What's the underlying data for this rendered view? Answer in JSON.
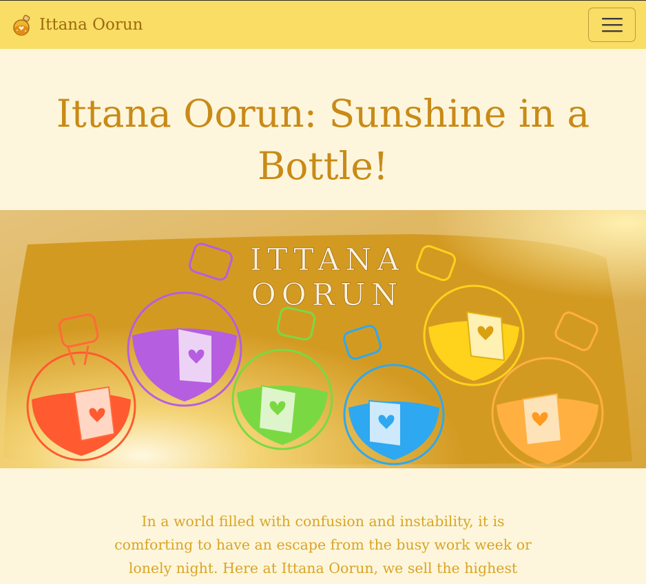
{
  "navbar": {
    "brand_name": "Ittana Oorun",
    "logo_icon": "potion-bottle-logo-icon",
    "menu_icon": "hamburger-menu-icon"
  },
  "hero": {
    "title": "Ittana Oorun: Sunshine in a Bottle!"
  },
  "banner": {
    "heading_line1": "ITTANA",
    "heading_line2": "OORUN",
    "bottles": [
      {
        "icon": "potion-bottle-icon",
        "color": "#ff5a30"
      },
      {
        "icon": "potion-bottle-icon",
        "color": "#b65ee0"
      },
      {
        "icon": "potion-bottle-icon",
        "color": "#7ad943"
      },
      {
        "icon": "potion-bottle-icon",
        "color": "#2ea8f0"
      },
      {
        "icon": "potion-bottle-icon",
        "color": "#ffd21c"
      },
      {
        "icon": "potion-bottle-icon",
        "color": "#ffb040"
      }
    ]
  },
  "intro": {
    "text": "In a world filled with confusion and instability, it is comforting to have an escape from the busy work week or lonely night. Here at Ittana Oorun, we sell the highest"
  },
  "colors": {
    "navbar_bg": "#f9dd64",
    "page_bg": "#fdf6dc",
    "title": "#c98a17",
    "body_text": "#d9a526",
    "banner_gold": "#d49a22"
  }
}
